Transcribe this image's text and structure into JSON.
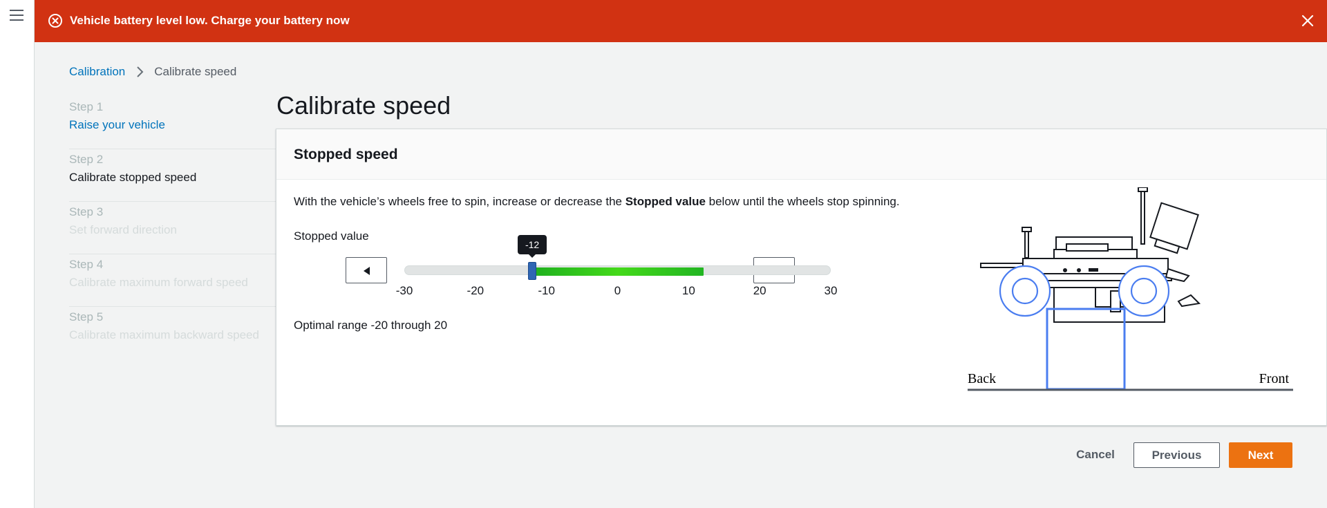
{
  "nav": {
    "menu_icon": "hamburger-menu-icon"
  },
  "banner": {
    "message": "Vehicle battery level low. Charge your battery now",
    "icon": "error-circle-icon",
    "close_icon": "close-icon",
    "color": "#d13212"
  },
  "breadcrumb": {
    "parent": "Calibration",
    "current": "Calibrate speed"
  },
  "steps": [
    {
      "number": "Step 1",
      "title": "Raise your vehicle",
      "state": "link"
    },
    {
      "number": "Step 2",
      "title": "Calibrate stopped speed",
      "state": "active"
    },
    {
      "number": "Step 3",
      "title": "Set forward direction",
      "state": "disabled"
    },
    {
      "number": "Step 4",
      "title": "Calibrate maximum forward speed",
      "state": "disabled"
    },
    {
      "number": "Step 5",
      "title": "Calibrate maximum backward speed",
      "state": "disabled"
    }
  ],
  "page_title": "Calibrate speed",
  "card": {
    "title": "Stopped speed",
    "desc_before": "With the vehicle’s wheels free to spin, increase or decrease the ",
    "desc_bold": "Stopped value",
    "desc_after": " below until the wheels stop spinning.",
    "slider_label": "Stopped value",
    "optimal_text": "Optimal range -20 through 20"
  },
  "slider": {
    "min": -30,
    "max": 30,
    "value": -12,
    "value_label": "-12",
    "green_from": -12,
    "green_to": 12,
    "ticks": [
      "-30",
      "-20",
      "-10",
      "0",
      "10",
      "20",
      "30"
    ],
    "decrement_icon": "caret-left-icon",
    "increment_icon": "caret-right-icon",
    "accent": "#2f66b3",
    "fill_color": "#44d91a"
  },
  "figure": {
    "back_label": "Back",
    "front_label": "Front",
    "wheel_color": "#4a7df0"
  },
  "footer": {
    "cancel": "Cancel",
    "previous": "Previous",
    "next": "Next",
    "primary_color": "#ec7211"
  }
}
